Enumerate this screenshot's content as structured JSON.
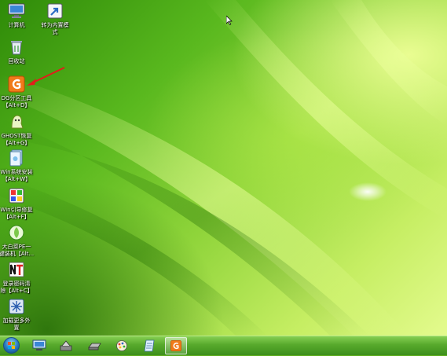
{
  "desktop": {
    "icons": [
      {
        "label": "计算机"
      },
      {
        "label": "转为内置模\n式"
      },
      {
        "label": "回收站"
      },
      {
        "label": "DG分区工具\n【Alt+D】"
      },
      {
        "label": "GHOST恢复\n【Alt+G】"
      },
      {
        "label": "Win系统安装\n【Alt+W】"
      },
      {
        "label": "Win引导修复\n【Alt+F】"
      },
      {
        "label": "大白菜PE一\n键装机【Alt..."
      },
      {
        "label": "登录密码清\n除【Alt+C】"
      },
      {
        "label": "加载更多外\n置"
      }
    ]
  },
  "taskbar": {
    "items": [
      "start-orb",
      "computer",
      "tools",
      "drive",
      "paint",
      "docs",
      "diskgenius"
    ],
    "active_item": "diskgenius"
  },
  "colors": {
    "wallpaper_base": "#5fae1c",
    "taskbar": "#57a92c",
    "annotation_arrow": "#e41b1b",
    "diskgenius_orange": "#f07a1a"
  }
}
